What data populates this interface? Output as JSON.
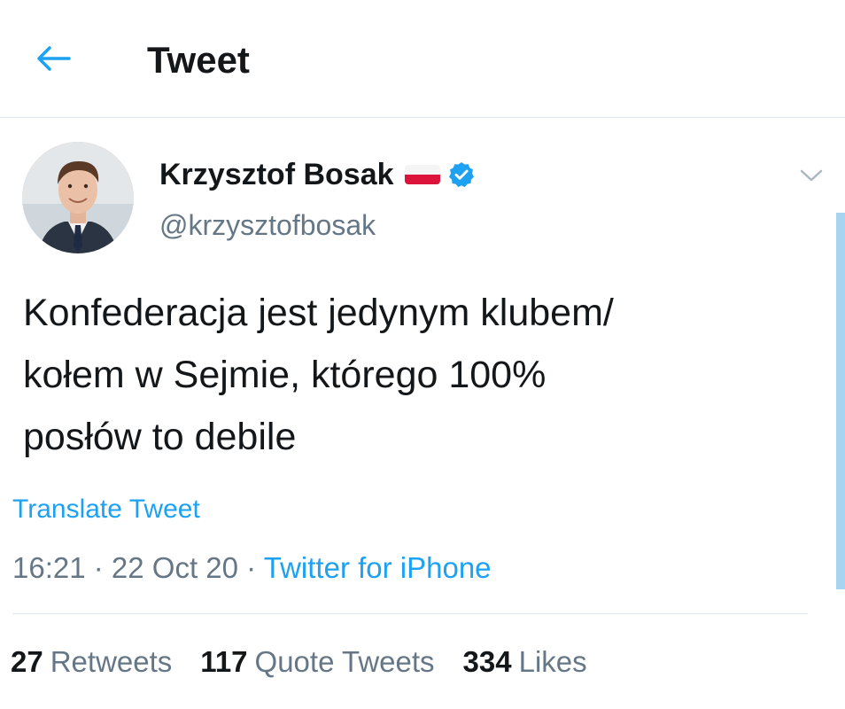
{
  "header": {
    "title": "Tweet",
    "back_icon": "arrow-left-icon"
  },
  "author": {
    "name": "Krzysztof Bosak",
    "handle": "@krzysztofbosak",
    "flag_icon": "poland-flag-icon",
    "verified_icon": "verified-badge-icon"
  },
  "tweet": {
    "text": "Konfederacja jest jedynym klubem/\nkołem w Sejmie, którego 100%\nposłów to debile",
    "translate_label": "Translate Tweet",
    "time": "16:21",
    "sep1": " · ",
    "date": "22 Oct 20",
    "sep2": " · ",
    "source": "Twitter for iPhone"
  },
  "stats": {
    "retweets_count": "27",
    "retweets_label": "Retweets",
    "quotes_count": "117",
    "quotes_label": "Quote Tweets",
    "likes_count": "334",
    "likes_label": "Likes"
  },
  "colors": {
    "accent": "#1da1f2",
    "secondary_text": "#657786",
    "divider": "#e1e8ed"
  }
}
